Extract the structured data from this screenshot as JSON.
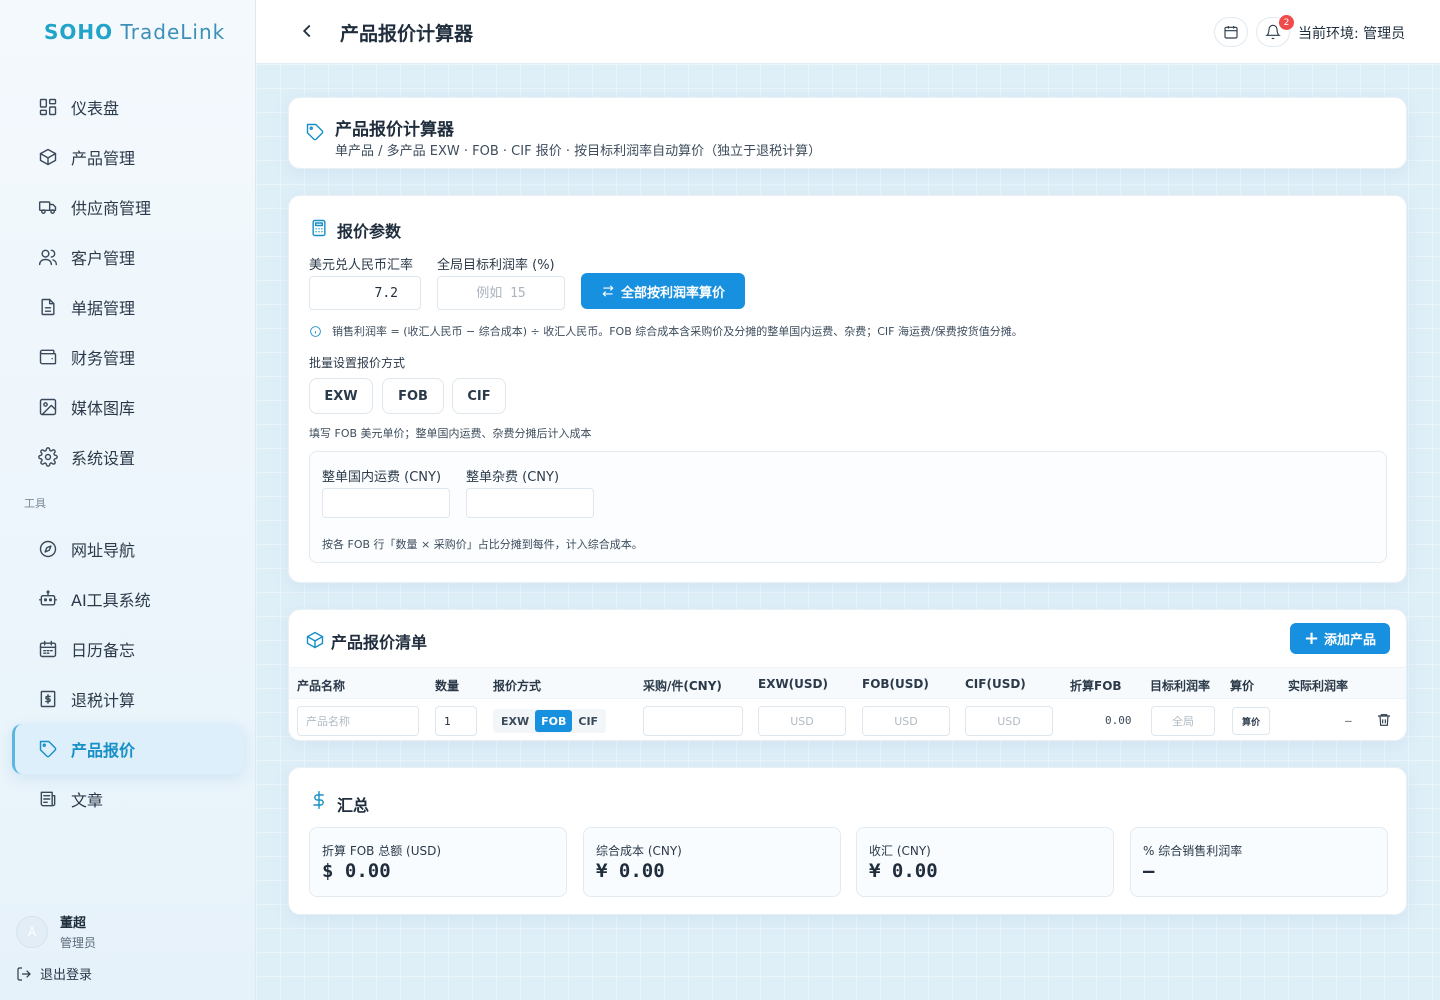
{
  "brand": {
    "part1": "SOHO",
    "part2": "TradeLink"
  },
  "sidebar": {
    "items": [
      {
        "label": "仪表盘",
        "icon": "dashboard-icon"
      },
      {
        "label": "产品管理",
        "icon": "box-icon"
      },
      {
        "label": "供应商管理",
        "icon": "truck-icon"
      },
      {
        "label": "客户管理",
        "icon": "users-icon"
      },
      {
        "label": "单据管理",
        "icon": "document-icon"
      },
      {
        "label": "财务管理",
        "icon": "wallet-icon"
      },
      {
        "label": "媒体图库",
        "icon": "image-icon"
      },
      {
        "label": "系统设置",
        "icon": "gear-icon"
      }
    ],
    "section_tools": "工具",
    "tools": [
      {
        "label": "网址导航",
        "icon": "compass-icon"
      },
      {
        "label": "AI工具系统",
        "icon": "bot-icon"
      },
      {
        "label": "日历备忘",
        "icon": "calendar-icon"
      },
      {
        "label": "退税计算",
        "icon": "receipt-icon"
      },
      {
        "label": "产品报价",
        "icon": "tag-icon",
        "active": true
      },
      {
        "label": "文章",
        "icon": "newspaper-icon"
      }
    ],
    "user": {
      "avatar": "A",
      "name": "董超",
      "role": "管理员"
    },
    "logout": "退出登录"
  },
  "header": {
    "title": "产品报价计算器",
    "notification_count": "2",
    "env_label": "当前环境: 管理员"
  },
  "intro": {
    "title": "产品报价计算器",
    "subtitle": "单产品 / 多产品 EXW · FOB · CIF 报价 · 按目标利润率自动算价（独立于退税计算）"
  },
  "params": {
    "title": "报价参数",
    "rate_label": "美元兑人民币汇率",
    "rate_value": "7.2",
    "margin_label": "全局目标利润率 (%)",
    "margin_placeholder": "例如 15",
    "calc_all_button": "全部按利润率算价",
    "hint": "销售利润率 = (收汇人民币 − 综合成本) ÷ 收汇人民币。FOB 综合成本含采购价及分摊的整单国内运费、杂费；CIF 海运费/保费按货值分摊。",
    "batch_label": "批量设置报价方式",
    "modes": [
      "EXW",
      "FOB",
      "CIF"
    ],
    "mode_hint": "填写 FOB 美元单价；整单国内运费、杂费分摊后计入成本",
    "domestic_freight_label": "整单国内运费 (CNY)",
    "misc_fee_label": "整单杂费 (CNY)",
    "alloc_hint": "按各 FOB 行「数量 × 采购价」占比分摊到每件，计入综合成本。"
  },
  "list": {
    "title": "产品报价清单",
    "add_button": "添加产品",
    "columns": [
      "产品名称",
      "数量",
      "报价方式",
      "采购/件(CNY)",
      "EXW(USD)",
      "FOB(USD)",
      "CIF(USD)",
      "折算FOB",
      "目标利润率",
      "算价",
      "实际利润率"
    ],
    "row": {
      "name_placeholder": "产品名称",
      "qty": "1",
      "modes": [
        "EXW",
        "FOB",
        "CIF"
      ],
      "selected_mode": "FOB",
      "usd_placeholder": "USD",
      "converted_fob": "0.00",
      "margin_placeholder": "全局",
      "calc_label": "算价",
      "actual_margin": "–"
    }
  },
  "summary": {
    "title": "汇总",
    "items": [
      {
        "label": "折算 FOB 总额 (USD)",
        "value": "$ 0.00"
      },
      {
        "label": "综合成本 (CNY)",
        "value": "¥ 0.00"
      },
      {
        "label": "收汇 (CNY)",
        "value": "¥ 0.00"
      },
      {
        "label": "% 综合销售利润率",
        "value": "—"
      }
    ]
  },
  "colors": {
    "accent": "#1890e0",
    "brand": "#22a3c9",
    "badge": "#f04a4a"
  }
}
